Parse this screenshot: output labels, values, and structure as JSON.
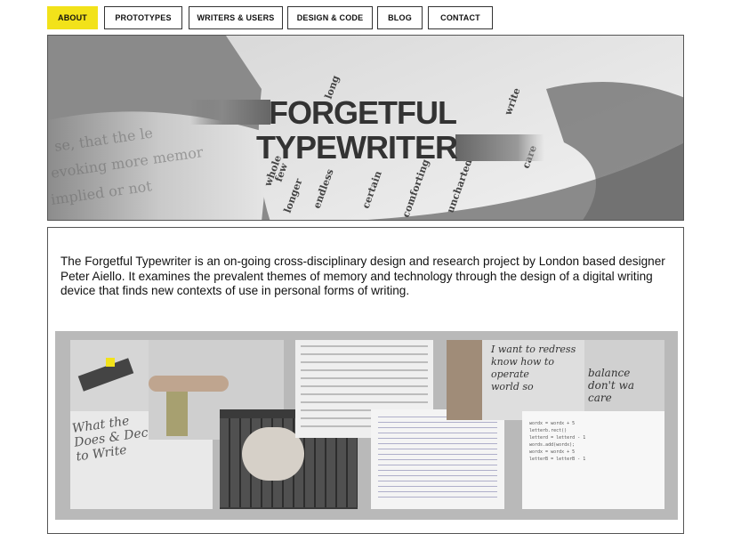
{
  "nav": {
    "items": [
      {
        "label": "ABOUT",
        "active": true
      },
      {
        "label": "PROTOTYPES",
        "active": false
      },
      {
        "label": "WRITERS & USERS",
        "active": false
      },
      {
        "label": "DESIGN & CODE",
        "active": false
      },
      {
        "label": "BLOG",
        "active": false
      },
      {
        "label": "CONTACT",
        "active": false
      }
    ]
  },
  "hero": {
    "title_line1": "FORGETFUL",
    "title_line2": "TYPEWRITER",
    "book_words": [
      "long",
      "certain",
      "uncharted",
      "comforting",
      "endless",
      "whole",
      "few",
      "longer",
      "write",
      "care"
    ]
  },
  "intro": {
    "text": "The Forgetful Typewriter is an on-going cross-disciplinary design and research project by London based designer Peter Aiello. It examines the prevalent themes of memory and technology through the design of a digital writing device that finds new contexts of use in personal forms of writing."
  },
  "collage": {
    "poster_text": [
      "What the",
      "Does & Dec",
      "to Write"
    ],
    "handwriting": [
      "world so",
      "balance",
      "don't wa",
      "care",
      "know how to operate",
      "I want to redress"
    ],
    "code_lines": [
      "wordx = wordx + 5",
      "letterb.rect()",
      "letterd = letterd - 1",
      "words.add(wordx);",
      "wordx = wordx + 5",
      "letterB = letterB - 1"
    ]
  },
  "colors": {
    "accent": "#f2e21a",
    "border": "#555555",
    "collage_bg": "#b9b9b9"
  }
}
